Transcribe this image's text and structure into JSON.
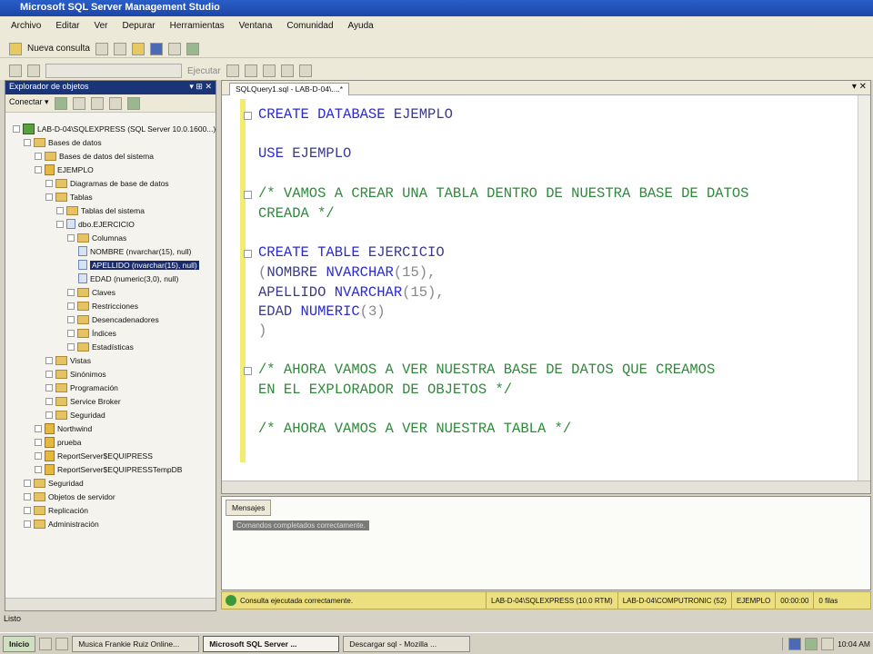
{
  "window": {
    "title": "Microsoft SQL Server Management Studio"
  },
  "menu": [
    "Archivo",
    "Editar",
    "Ver",
    "Depurar",
    "Herramientas",
    "Ventana",
    "Comunidad",
    "Ayuda"
  ],
  "toolbar": {
    "new_query": "Nueva consulta",
    "execute": "Ejecutar"
  },
  "object_explorer": {
    "title": "Explorador de objetos",
    "connect": "Conectar ▾",
    "tree": [
      {
        "level": 0,
        "icon": "srv",
        "label": "LAB-D-04\\SQLEXPRESS (SQL Server 10.0.1600...)"
      },
      {
        "level": 1,
        "icon": "fold",
        "label": "Bases de datos"
      },
      {
        "level": 2,
        "icon": "fold",
        "label": "Bases de datos del sistema"
      },
      {
        "level": 2,
        "icon": "db",
        "label": "EJEMPLO"
      },
      {
        "level": 3,
        "icon": "fold",
        "label": "Diagramas de base de datos"
      },
      {
        "level": 3,
        "icon": "fold",
        "label": "Tablas"
      },
      {
        "level": 4,
        "icon": "fold",
        "label": "Tablas del sistema"
      },
      {
        "level": 4,
        "icon": "col",
        "label": "dbo.EJERCICIO"
      },
      {
        "level": 5,
        "icon": "fold",
        "label": "Columnas"
      },
      {
        "level": 6,
        "icon": "col",
        "label": "NOMBRE (nvarchar(15), null)"
      },
      {
        "level": 6,
        "icon": "col",
        "label": "APELLIDO (nvarchar(15), null)",
        "selected": true
      },
      {
        "level": 6,
        "icon": "col",
        "label": "EDAD (numeric(3,0), null)"
      },
      {
        "level": 5,
        "icon": "fold",
        "label": "Claves"
      },
      {
        "level": 5,
        "icon": "fold",
        "label": "Restricciones"
      },
      {
        "level": 5,
        "icon": "fold",
        "label": "Desencadenadores"
      },
      {
        "level": 5,
        "icon": "fold",
        "label": "Índices"
      },
      {
        "level": 5,
        "icon": "fold",
        "label": "Estadísticas"
      },
      {
        "level": 3,
        "icon": "fold",
        "label": "Vistas"
      },
      {
        "level": 3,
        "icon": "fold",
        "label": "Sinónimos"
      },
      {
        "level": 3,
        "icon": "fold",
        "label": "Programación"
      },
      {
        "level": 3,
        "icon": "fold",
        "label": "Service Broker"
      },
      {
        "level": 3,
        "icon": "fold",
        "label": "Seguridad"
      },
      {
        "level": 2,
        "icon": "db",
        "label": "Northwind"
      },
      {
        "level": 2,
        "icon": "db",
        "label": "prueba"
      },
      {
        "level": 2,
        "icon": "db",
        "label": "ReportServer$EQUIPRESS"
      },
      {
        "level": 2,
        "icon": "db",
        "label": "ReportServer$EQUIPRESSTempDB"
      },
      {
        "level": 1,
        "icon": "fold",
        "label": "Seguridad"
      },
      {
        "level": 1,
        "icon": "fold",
        "label": "Objetos de servidor"
      },
      {
        "level": 1,
        "icon": "fold",
        "label": "Replicación"
      },
      {
        "level": 1,
        "icon": "fold",
        "label": "Administración"
      }
    ]
  },
  "editor": {
    "tab": "SQLQuery1.sql - LAB-D-04\\....*",
    "lines": [
      {
        "fold": true,
        "tokens": [
          {
            "t": "CREATE DATABASE ",
            "c": "kw"
          },
          {
            "t": "EJEMPLO",
            "c": "id"
          }
        ]
      },
      {
        "fold": false,
        "tokens": [
          {
            "t": "USE ",
            "c": "kw"
          },
          {
            "t": "EJEMPLO",
            "c": "id"
          }
        ]
      },
      {
        "fold": true,
        "tokens": [
          {
            "t": "/* VAMOS A CREAR UNA TABLA DENTRO DE NUESTRA BASE DE DATOS",
            "c": "cm"
          }
        ]
      },
      {
        "fold": false,
        "tokens": [
          {
            "t": "CREADA */",
            "c": "cm"
          }
        ]
      },
      {
        "fold": true,
        "tokens": [
          {
            "t": "CREATE TABLE ",
            "c": "kw"
          },
          {
            "t": "EJERCICIO",
            "c": "id"
          }
        ]
      },
      {
        "fold": false,
        "tokens": [
          {
            "t": "(",
            "c": "pn"
          },
          {
            "t": "NOMBRE ",
            "c": "id"
          },
          {
            "t": "NVARCHAR",
            "c": "kw"
          },
          {
            "t": "(15),",
            "c": "pn"
          }
        ]
      },
      {
        "fold": false,
        "tokens": [
          {
            "t": "APELLIDO ",
            "c": "id"
          },
          {
            "t": "NVARCHAR",
            "c": "kw"
          },
          {
            "t": "(15),",
            "c": "pn"
          }
        ]
      },
      {
        "fold": false,
        "tokens": [
          {
            "t": "EDAD ",
            "c": "id"
          },
          {
            "t": "NUMERIC",
            "c": "kw"
          },
          {
            "t": "(3)",
            "c": "pn"
          }
        ]
      },
      {
        "fold": false,
        "tokens": [
          {
            "t": ")",
            "c": "pn"
          }
        ]
      },
      {
        "fold": true,
        "tokens": [
          {
            "t": "/* AHORA VAMOS A VER NUESTRA BASE DE DATOS QUE CREAMOS",
            "c": "cm"
          }
        ]
      },
      {
        "fold": false,
        "tokens": [
          {
            "t": "EN EL EXPLORADOR DE OBJETOS */",
            "c": "cm"
          }
        ]
      },
      {
        "fold": false,
        "tokens": [
          {
            "t": "/* AHORA VAMOS A VER NUESTRA TABLA */",
            "c": "cm"
          }
        ]
      }
    ]
  },
  "messages": {
    "tab": "Mensajes",
    "text": "Comandos completados correctamente."
  },
  "statusbar": {
    "message": "Consulta ejecutada correctamente.",
    "server": "LAB-D-04\\SQLEXPRESS (10.0 RTM)",
    "user": "LAB-D-04\\COMPUTRONIC (52)",
    "database": "EJEMPLO",
    "time": "00:00:00",
    "rows": "0 filas"
  },
  "app_status": "Listo",
  "taskbar": {
    "start": "Inicio",
    "items": [
      "Musica Frankie Ruiz Online...",
      "Microsoft SQL Server ...",
      "Descargar sql - Mozilla ..."
    ],
    "clock": "10:04 AM"
  }
}
